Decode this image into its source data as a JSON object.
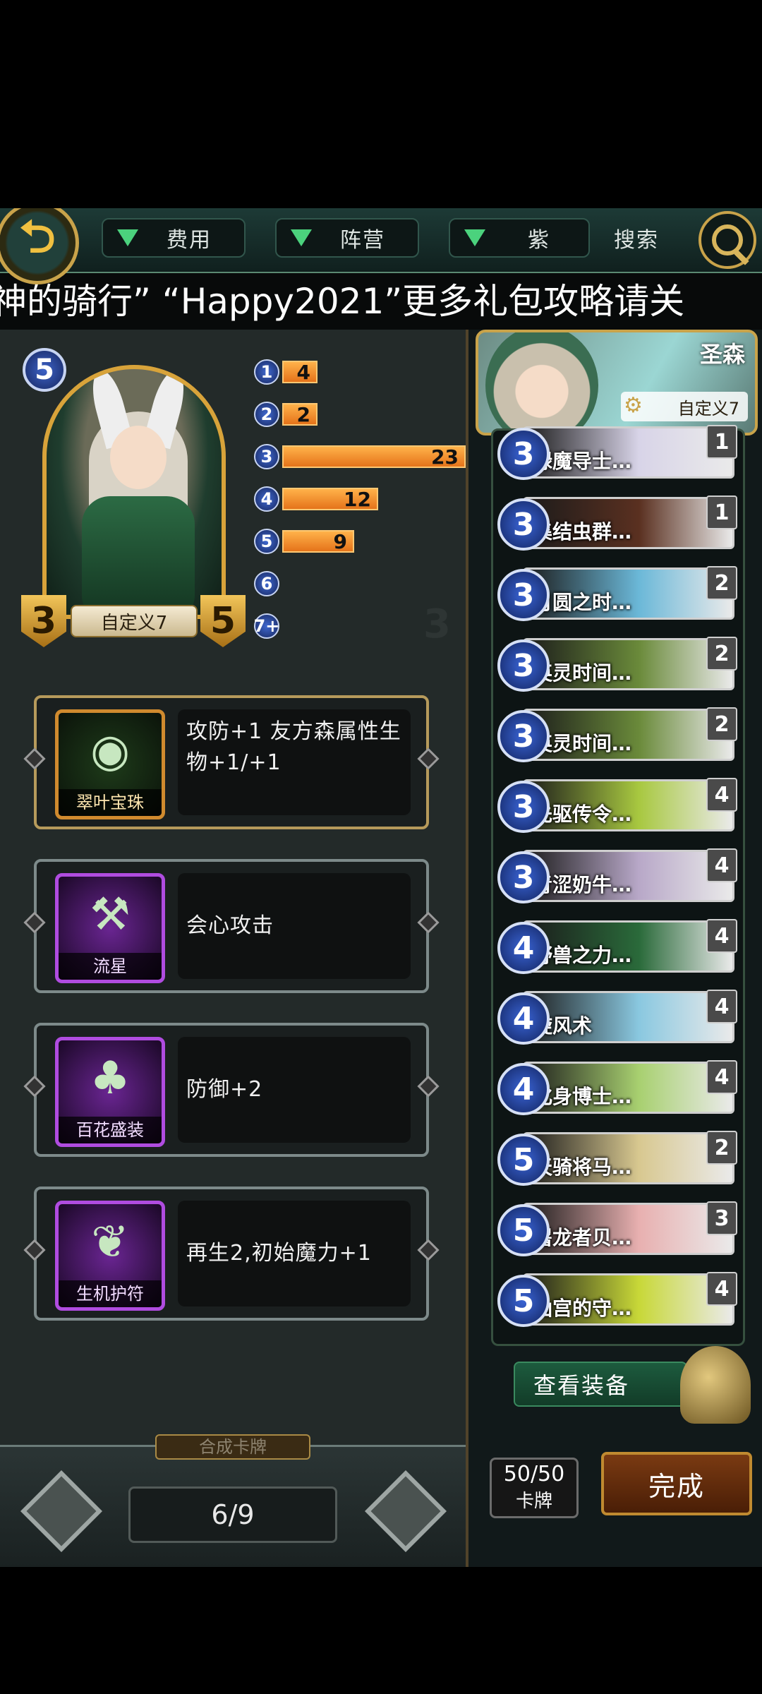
{
  "topbar": {
    "back_icon": "undo-arrow-icon",
    "filters": [
      "费用",
      "阵营",
      "紫"
    ],
    "search_label": "搜索",
    "search_icon": "magnifier-icon"
  },
  "marquee": {
    "text": "神的骑行”  “Happy2021”更多礼包攻略请关"
  },
  "card": {
    "cost": "5",
    "attack": "3",
    "health": "5",
    "name": "自定义7"
  },
  "cost_histogram": [
    {
      "cost": "1",
      "count": 4
    },
    {
      "cost": "2",
      "count": 2
    },
    {
      "cost": "3",
      "count": 23
    },
    {
      "cost": "4",
      "count": 12
    },
    {
      "cost": "5",
      "count": 9
    },
    {
      "cost": "6",
      "count": 0
    },
    {
      "cost": "7+",
      "count": 0
    }
  ],
  "equipment": [
    {
      "name": "翠叶宝珠",
      "desc": "攻防+1 友方森属性生物+1/+1",
      "icon": "green-orb-icon",
      "rarity": "gold"
    },
    {
      "name": "流星",
      "desc": "会心攻击",
      "icon": "meteor-hammer-icon",
      "rarity": "purple"
    },
    {
      "name": "百花盛装",
      "desc": "防御+2",
      "icon": "flower-dress-icon",
      "rarity": "purple"
    },
    {
      "name": "生机护符",
      "desc": "再生2,初始魔力+1",
      "icon": "leaf-amulet-icon",
      "rarity": "purple"
    }
  ],
  "pager": {
    "tab": "合成卡牌",
    "value": "6/9"
  },
  "deck": {
    "faction": "圣森",
    "name": "自定义7",
    "cards": [
      {
        "cost": "3",
        "name": "绿魔导士…",
        "count": "1",
        "color": "#d8d4e8"
      },
      {
        "cost": "3",
        "name": "集结虫群…",
        "count": "1",
        "color": "#5a3020"
      },
      {
        "cost": "3",
        "name": "月圆之时…",
        "count": "2",
        "color": "#6bb8d8"
      },
      {
        "cost": "3",
        "name": "英灵时间…",
        "count": "2",
        "color": "#6a8a3a"
      },
      {
        "cost": "3",
        "name": "英灵时间…",
        "count": "2",
        "color": "#6a8a3a"
      },
      {
        "cost": "3",
        "name": "先驱传令…",
        "count": "4",
        "color": "#a8c840"
      },
      {
        "cost": "3",
        "name": "青涩奶牛…",
        "count": "4",
        "color": "#b8a8c8"
      },
      {
        "cost": "4",
        "name": "野兽之力…",
        "count": "4",
        "color": "#2a6a3a"
      },
      {
        "cost": "4",
        "name": "旋风术",
        "count": "4",
        "color": "#8ac8e0"
      },
      {
        "cost": "4",
        "name": "化身博士…",
        "count": "4",
        "color": "#a8d070"
      },
      {
        "cost": "5",
        "name": "天骑将马…",
        "count": "2",
        "color": "#d8c890"
      },
      {
        "cost": "5",
        "name": "屠龙者贝…",
        "count": "3",
        "color": "#e8b0b0"
      },
      {
        "cost": "5",
        "name": "仙宫的守…",
        "count": "4",
        "color": "#c8d838"
      }
    ],
    "view_equip_label": "查看装备",
    "card_count": "50/50",
    "card_count_label": "卡牌",
    "done_label": "完成"
  }
}
